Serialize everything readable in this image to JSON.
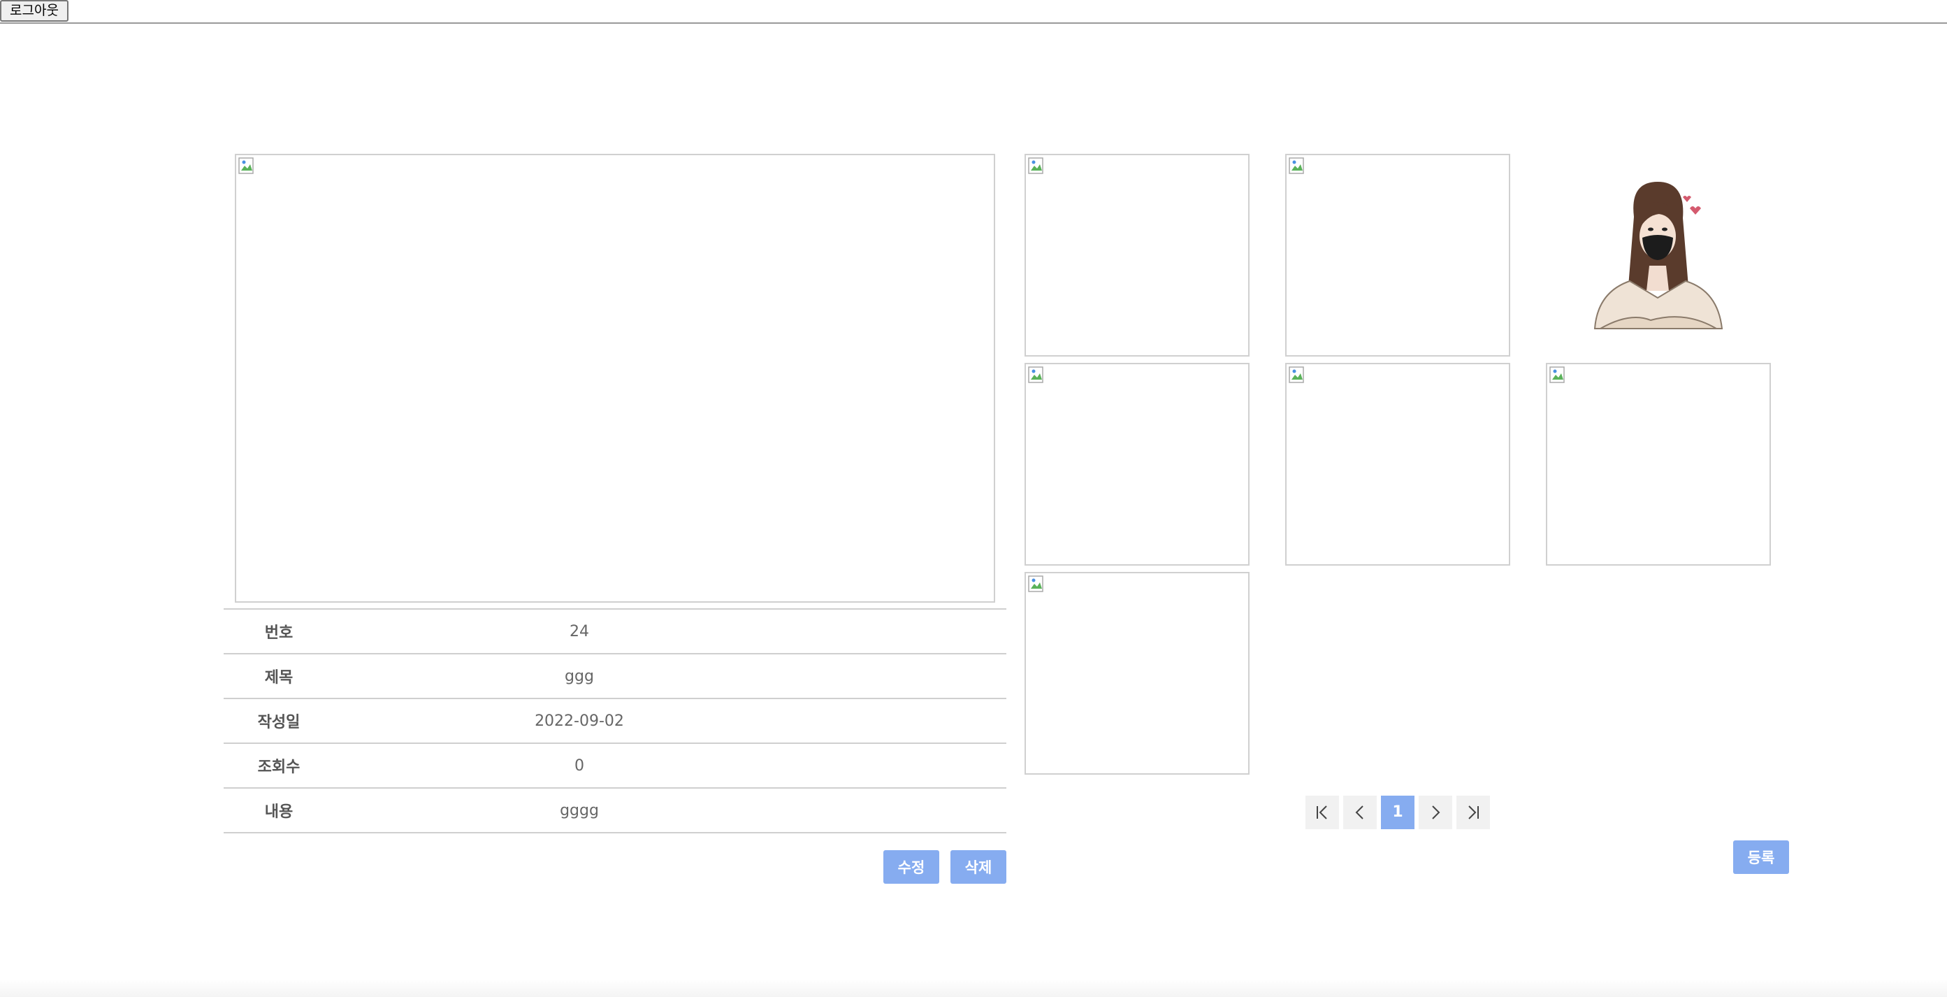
{
  "header": {
    "logout_label": "로그아웃"
  },
  "detail": {
    "rows": [
      {
        "label": "번호",
        "value": "24"
      },
      {
        "label": "제목",
        "value": "ggg"
      },
      {
        "label": "작성일",
        "value": "2022-09-02"
      },
      {
        "label": "조회수",
        "value": "0"
      },
      {
        "label": "내용",
        "value": "gggg"
      }
    ],
    "edit_label": "수정",
    "delete_label": "삭제"
  },
  "pagination": {
    "first_icon": "first-page-icon",
    "prev_icon": "chevron-left-icon",
    "current_page": "1",
    "next_icon": "chevron-right-icon",
    "last_icon": "last-page-icon"
  },
  "register_label": "등록",
  "colors": {
    "accent": "#86acf0",
    "pager_bg": "#f1f1f1",
    "border": "#cfcfcf"
  }
}
